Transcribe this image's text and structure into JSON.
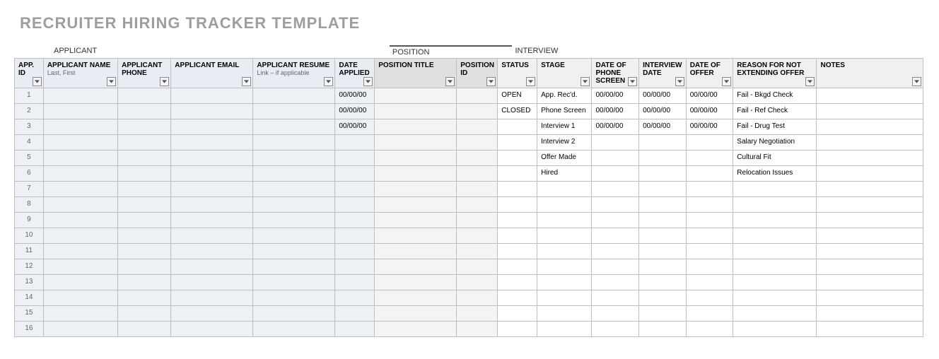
{
  "title": "RECRUITER HIRING TRACKER TEMPLATE",
  "sections": {
    "applicant": "APPLICANT",
    "position": "POSITION",
    "interview": "INTERVIEW"
  },
  "columns": {
    "app_id": "APP. ID",
    "applicant_name": "APPLICANT NAME",
    "applicant_name_sub": "Last, First",
    "applicant_phone": "APPLICANT PHONE",
    "applicant_email": "APPLICANT EMAIL",
    "applicant_resume": "APPLICANT RESUME",
    "applicant_resume_sub": "Link – if applicable",
    "date_applied": "DATE APPLIED",
    "position_title": "POSITION TITLE",
    "position_id": "POSITION ID",
    "status": "STATUS",
    "stage": "STAGE",
    "date_phone_screen": "DATE OF PHONE SCREEN",
    "interview_date": "INTERVIEW DATE",
    "date_offer": "DATE OF OFFER",
    "reason": "REASON FOR NOT EXTENDING OFFER",
    "notes": "NOTES"
  },
  "rows": [
    {
      "n": "1",
      "date_applied": "00/00/00",
      "status": "OPEN",
      "stage": "App. Rec'd.",
      "dps": "00/00/00",
      "idate": "00/00/00",
      "ofdate": "00/00/00",
      "reason": "Fail - Bkgd Check"
    },
    {
      "n": "2",
      "date_applied": "00/00/00",
      "status": "CLOSED",
      "stage": "Phone Screen",
      "dps": "00/00/00",
      "idate": "00/00/00",
      "ofdate": "00/00/00",
      "reason": "Fail - Ref Check"
    },
    {
      "n": "3",
      "date_applied": "00/00/00",
      "status": "",
      "stage": "Interview 1",
      "dps": "00/00/00",
      "idate": "00/00/00",
      "ofdate": "00/00/00",
      "reason": "Fail - Drug Test"
    },
    {
      "n": "4",
      "date_applied": "",
      "status": "",
      "stage": "Interview 2",
      "dps": "",
      "idate": "",
      "ofdate": "",
      "reason": "Salary Negotiation"
    },
    {
      "n": "5",
      "date_applied": "",
      "status": "",
      "stage": "Offer Made",
      "dps": "",
      "idate": "",
      "ofdate": "",
      "reason": "Cultural Fit"
    },
    {
      "n": "6",
      "date_applied": "",
      "status": "",
      "stage": "Hired",
      "dps": "",
      "idate": "",
      "ofdate": "",
      "reason": "Relocation Issues"
    },
    {
      "n": "7"
    },
    {
      "n": "8"
    },
    {
      "n": "9"
    },
    {
      "n": "10"
    },
    {
      "n": "11"
    },
    {
      "n": "12"
    },
    {
      "n": "13"
    },
    {
      "n": "14"
    },
    {
      "n": "15"
    },
    {
      "n": "16"
    }
  ]
}
